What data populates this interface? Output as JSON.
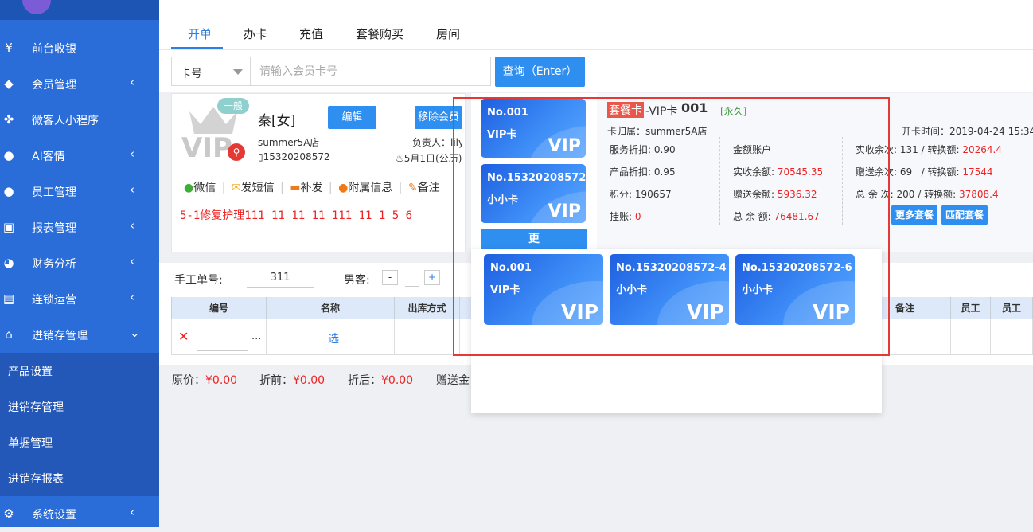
{
  "sidebar": {
    "items": [
      {
        "label": "前台收银",
        "icon": "yen-icon"
      },
      {
        "label": "会员管理",
        "icon": "diamond-icon"
      },
      {
        "label": "微客人小程序",
        "icon": "clover-icon"
      },
      {
        "label": "AI客情",
        "icon": "user-ai-icon"
      },
      {
        "label": "员工管理",
        "icon": "user-icon"
      },
      {
        "label": "报表管理",
        "icon": "monitor-icon"
      },
      {
        "label": "财务分析",
        "icon": "pie-chart-icon"
      },
      {
        "label": "连锁运营",
        "icon": "building-icon"
      },
      {
        "label": "进销存管理",
        "icon": "home-icon"
      },
      {
        "label": "系统设置",
        "icon": "gear-icon"
      }
    ],
    "subitems": [
      "产品设置",
      "进销存管理",
      "单据管理",
      "进销存报表"
    ],
    "collapse_chevron": "‹",
    "expand_chevron": "⌄"
  },
  "tabs": [
    "开单",
    "办卡",
    "充值",
    "套餐购买",
    "房间"
  ],
  "search": {
    "type_value": "卡号",
    "placeholder": "请输入会员卡号",
    "button": "查询（Enter）"
  },
  "member": {
    "level_badge": "一般",
    "vip_logo": "VIP",
    "name": "秦[女]",
    "edit_button": "编辑",
    "remove_button": "移除会员",
    "store": "summer5A店",
    "manager": "负责人：lily",
    "phone": "15320208572",
    "birthday": "5月1日(公历)",
    "actions": [
      "微信",
      "发短信",
      "补发",
      "附属信息",
      "备注"
    ],
    "note": "5-1修复护理111 11 11 11 111 11 1 5 6"
  },
  "cards": [
    {
      "no": "No.001",
      "name": "VIP卡",
      "logo": "VIP"
    },
    {
      "no": "No.15320208572-4",
      "name": "小小卡",
      "logo": "VIP"
    },
    {
      "no": "No.15320208572-6",
      "name": "小小卡",
      "logo": "VIP"
    }
  ],
  "more_button": "更",
  "card_detail": {
    "type_tag": "套餐卡",
    "card_name": "-VIP卡",
    "card_no": "001",
    "validity": "[永久]",
    "belong_label": "卡归属：",
    "belong_value": "summer5A店",
    "open_label": "开卡时间：",
    "open_value": "2019-04-24 15:34",
    "service_discount": "服务折扣: 0.90",
    "product_discount": "产品折扣: 0.95",
    "points": "积分: 190657",
    "debt_label": "挂账:",
    "debt_value": "0",
    "account_label": "金额账户",
    "real_balance_label": "实收余额:",
    "real_balance": "70545.35",
    "gift_balance_label": "赠送余额:",
    "gift_balance": "5936.32",
    "total_balance_label": "总 余 额:",
    "total_balance": "76481.67",
    "real_times_label": "实收余次: 131",
    "real_convert_label": "/ 转换额:",
    "real_convert": "20264.4",
    "gift_times_label": "赠送余次: 69",
    "gift_convert_label": "/ 转换额:",
    "gift_convert": "17544",
    "total_times_label": "总 余 次: 200",
    "total_convert_label": "/ 转换额:",
    "total_convert": "37808.4",
    "more_packages": "更多套餐",
    "match_packages": "匹配套餐"
  },
  "order": {
    "manual_no_label": "手工单号:",
    "manual_no": "311",
    "male_label": "男客:",
    "minus": "-",
    "plus": "+",
    "columns": [
      "编号",
      "名称",
      "出库方式",
      "备注",
      "员工",
      "员工"
    ],
    "row_action": "选",
    "row_more": "...",
    "delete_icon": "✕"
  },
  "totals": {
    "original_label": "原价：",
    "original": "¥0.00",
    "before_label": "折前：",
    "before": "¥0.00",
    "after_label": "折后：",
    "after": "¥0.00",
    "gift_label": "赠送金"
  },
  "colors": {
    "sidebar": "#2a6cd8",
    "accent": "#2f7fe3",
    "highlight_border": "#e53935",
    "money_red": "#e22"
  }
}
